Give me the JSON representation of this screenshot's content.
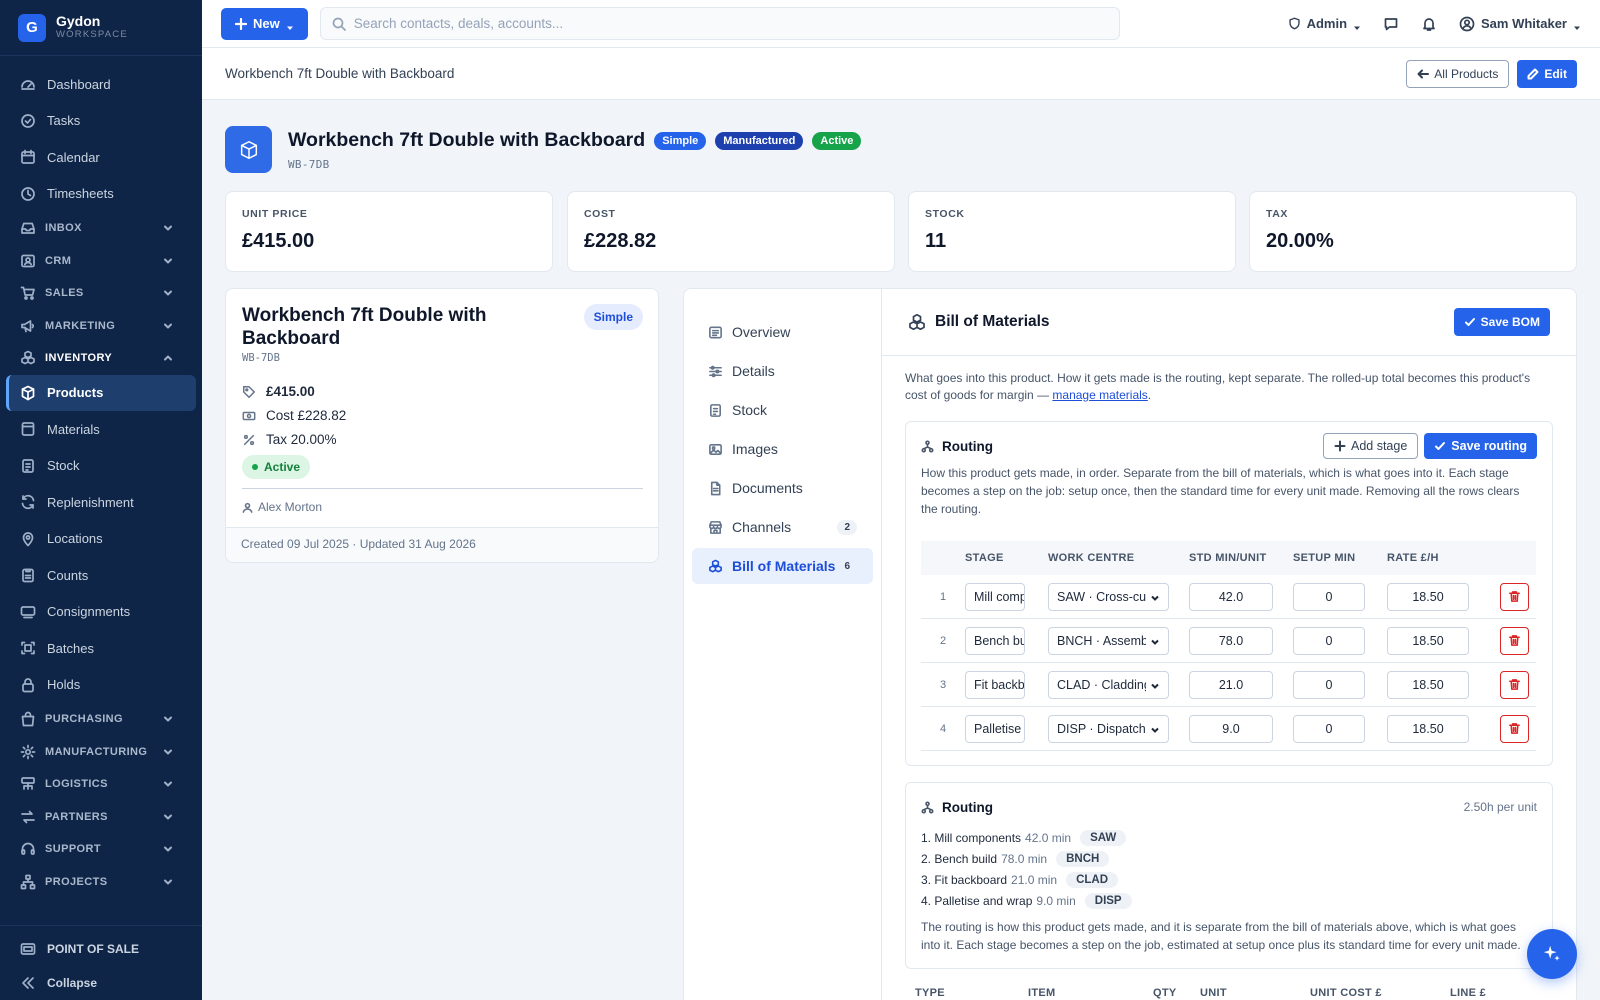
{
  "brand": {
    "name": "Gydon",
    "sub": "WORKSPACE",
    "logo_letter": "G"
  },
  "sidebar": {
    "items": [
      {
        "type": "item",
        "label": "Dashboard",
        "icon": "dashboard-icon"
      },
      {
        "type": "item",
        "label": "Tasks",
        "icon": "tasks-icon"
      },
      {
        "type": "item",
        "label": "Calendar",
        "icon": "calendar-icon"
      },
      {
        "type": "item",
        "label": "Timesheets",
        "icon": "clock-icon"
      },
      {
        "type": "group",
        "label": "INBOX",
        "icon": "inbox-icon"
      },
      {
        "type": "group",
        "label": "CRM",
        "icon": "contacts-icon"
      },
      {
        "type": "group",
        "label": "SALES",
        "icon": "cart-icon"
      },
      {
        "type": "group",
        "label": "MARKETING",
        "icon": "megaphone-icon"
      },
      {
        "type": "group",
        "label": "INVENTORY",
        "icon": "boxes-icon",
        "open": true
      },
      {
        "type": "item",
        "label": "Products",
        "icon": "cube-icon",
        "active": true
      },
      {
        "type": "item",
        "label": "Materials",
        "icon": "materials-icon"
      },
      {
        "type": "item",
        "label": "Stock",
        "icon": "stock-icon"
      },
      {
        "type": "item",
        "label": "Replenishment",
        "icon": "refresh-icon"
      },
      {
        "type": "item",
        "label": "Locations",
        "icon": "location-icon"
      },
      {
        "type": "item",
        "label": "Counts",
        "icon": "clipboard-icon"
      },
      {
        "type": "item",
        "label": "Consignments",
        "icon": "truck-icon"
      },
      {
        "type": "item",
        "label": "Batches",
        "icon": "batch-icon"
      },
      {
        "type": "item",
        "label": "Holds",
        "icon": "lock-icon"
      },
      {
        "type": "group",
        "label": "PURCHASING",
        "icon": "bag-icon"
      },
      {
        "type": "group",
        "label": "MANUFACTURING",
        "icon": "gear-icon"
      },
      {
        "type": "group",
        "label": "LOGISTICS",
        "icon": "logistics-icon"
      },
      {
        "type": "group",
        "label": "PARTNERS",
        "icon": "partners-icon"
      },
      {
        "type": "group",
        "label": "SUPPORT",
        "icon": "headset-icon"
      },
      {
        "type": "group",
        "label": "PROJECTS",
        "icon": "projects-icon"
      }
    ],
    "bottom": {
      "pos": "POINT OF SALE",
      "collapse": "Collapse"
    }
  },
  "topbar": {
    "new_label": "New",
    "search_placeholder": "Search contacts, deals, accounts...",
    "role": "Admin",
    "user": "Sam Whitaker"
  },
  "header": {
    "breadcrumb": "Workbench 7ft Double with Backboard",
    "all_products": "All Products",
    "edit": "Edit"
  },
  "product": {
    "title": "Workbench 7ft Double with Backboard",
    "badges": [
      "Simple",
      "Manufactured",
      "Active"
    ],
    "sku": "WB-7DB"
  },
  "stats": [
    {
      "label": "UNIT PRICE",
      "value": "£415.00"
    },
    {
      "label": "COST",
      "value": "£228.82"
    },
    {
      "label": "STOCK",
      "value": "11"
    },
    {
      "label": "TAX",
      "value": "20.00%"
    }
  ],
  "summary": {
    "title": "Workbench 7ft Double with Backboard",
    "badge": "Simple",
    "sku": "WB-7DB",
    "price": "£415.00",
    "cost": "Cost £228.82",
    "tax": "Tax 20.00%",
    "status": "Active",
    "owner": "Alex Morton",
    "footer": "Created 09 Jul 2025 · Updated 31 Aug 2026"
  },
  "tabs": [
    {
      "label": "Overview",
      "icon": "overview-icon"
    },
    {
      "label": "Details",
      "icon": "sliders-icon"
    },
    {
      "label": "Stock",
      "icon": "stock-icon"
    },
    {
      "label": "Images",
      "icon": "image-icon"
    },
    {
      "label": "Documents",
      "icon": "document-icon"
    },
    {
      "label": "Channels",
      "icon": "store-icon",
      "count": "2"
    },
    {
      "label": "Bill of Materials",
      "icon": "boxes-icon",
      "count": "6",
      "active": true
    }
  ],
  "bom": {
    "title": "Bill of Materials",
    "save_label": "Save BOM",
    "desc_before": "What goes into this product. How it gets made is the routing, kept separate. The rolled-up total becomes this product's cost of goods for margin — ",
    "desc_link": "manage materials",
    "desc_after": "."
  },
  "routing": {
    "title": "Routing",
    "add_stage": "Add stage",
    "save_routing": "Save routing",
    "desc": "How this product gets made, in order. Separate from the bill of materials, which is what goes into it. Each stage becomes a step on the job: setup once, then the standard time for every unit made. Removing all the rows clears the routing.",
    "columns": [
      "STAGE",
      "WORK CENTRE",
      "STD MIN/UNIT",
      "SETUP MIN",
      "RATE £/H"
    ],
    "rows": [
      {
        "num": "1",
        "stage": "Mill components",
        "work_centre": "SAW · Cross-cut",
        "std_min": "42.0",
        "setup_min": "0",
        "rate": "18.50"
      },
      {
        "num": "2",
        "stage": "Bench build",
        "work_centre": "BNCH · Assembly",
        "std_min": "78.0",
        "setup_min": "0",
        "rate": "18.50"
      },
      {
        "num": "3",
        "stage": "Fit backboard",
        "work_centre": "CLAD · Cladding",
        "std_min": "21.0",
        "setup_min": "0",
        "rate": "18.50"
      },
      {
        "num": "4",
        "stage": "Palletise and wrap",
        "work_centre": "DISP · Dispatch",
        "std_min": "9.0",
        "setup_min": "0",
        "rate": "18.50"
      }
    ]
  },
  "routing_summary": {
    "title": "Routing",
    "meta": "2.50h per unit",
    "steps": [
      {
        "label": "1. Mill components",
        "dur": "42.0 min",
        "code": "SAW"
      },
      {
        "label": "2. Bench build",
        "dur": "78.0 min",
        "code": "BNCH"
      },
      {
        "label": "3. Fit backboard",
        "dur": "21.0 min",
        "code": "CLAD"
      },
      {
        "label": "4. Palletise and wrap",
        "dur": "9.0 min",
        "code": "DISP"
      }
    ],
    "desc": "The routing is how this product gets made, and it is separate from the bill of materials above, which is what goes into it. Each stage becomes a step on the job, estimated at setup once plus its standard time for every unit made."
  },
  "materials_table": {
    "columns": [
      "TYPE",
      "ITEM",
      "QTY",
      "UNIT",
      "UNIT COST £",
      "LINE £"
    ]
  }
}
